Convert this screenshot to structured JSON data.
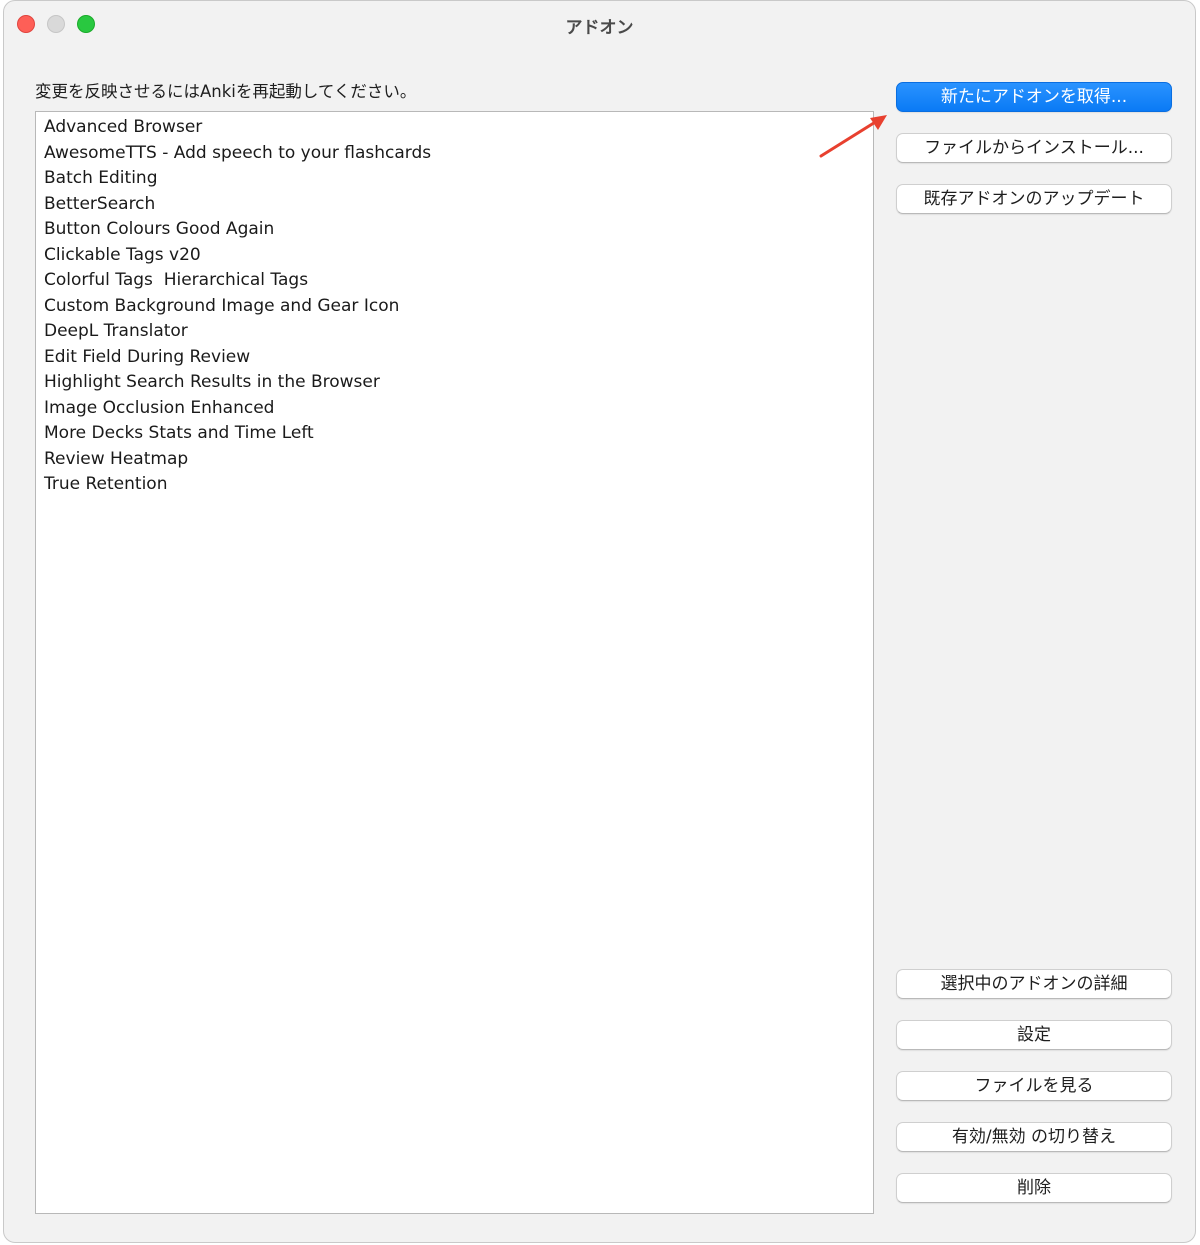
{
  "window": {
    "title": "アドオン"
  },
  "restart_note": "変更を反映させるにはAnkiを再起動してください。",
  "addons": [
    "Advanced Browser",
    "AwesomeTTS - Add speech to your flashcards",
    "Batch Editing",
    "BetterSearch",
    "Button Colours Good Again",
    "Clickable Tags v20",
    "Colorful Tags  Hierarchical Tags",
    "Custom Background Image and Gear Icon",
    "DeepL Translator",
    "Edit Field During Review",
    "Highlight Search Results in the Browser",
    "Image Occlusion Enhanced",
    "More Decks Stats and Time Left",
    "Review Heatmap",
    "True Retention"
  ],
  "buttons": {
    "get_addons": "新たにアドオンを取得...",
    "install_from_file": "ファイルからインストール...",
    "check_updates": "既存アドオンのアップデート",
    "view_details": "選択中のアドオンの詳細",
    "config": "設定",
    "view_files": "ファイルを見る",
    "toggle_enabled": "有効/無効 の切り替え",
    "delete": "削除"
  },
  "colors": {
    "accent": "#0a7af5",
    "annotation_arrow": "#e8402f",
    "close": "#fe5f57",
    "zoom": "#29c840"
  },
  "icons": {
    "annotation": "arrow-pointer-icon"
  }
}
